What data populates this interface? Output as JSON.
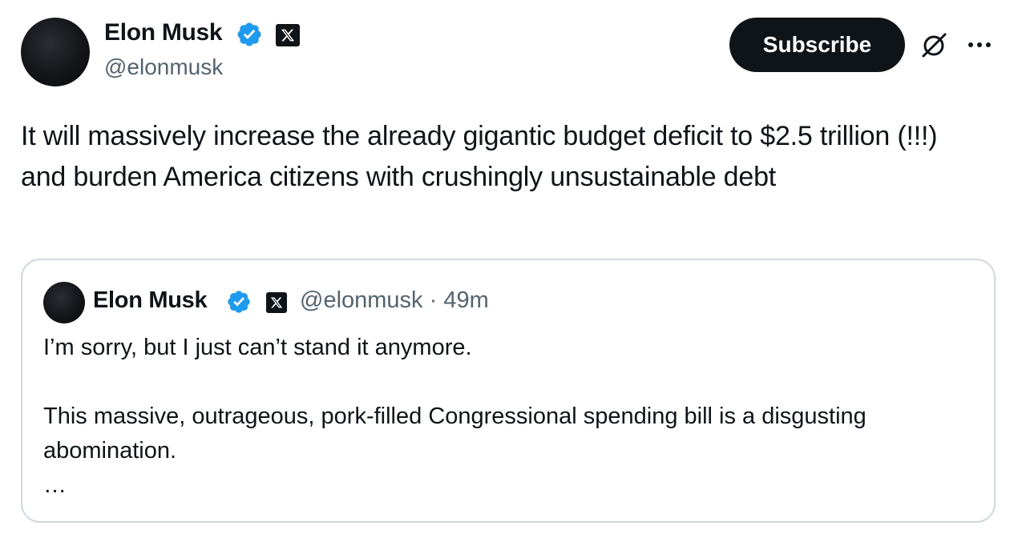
{
  "post": {
    "author": {
      "name": "Elon Musk",
      "handle": "@elonmusk",
      "verified_icon": "verified-badge-icon",
      "affiliate_icon": "x-logo-icon"
    },
    "subscribe_label": "Subscribe",
    "body": "It will massively increase the already gigantic budget deficit to $2.5 trillion (!!!) and burden America citizens with crushingly unsustainable debt"
  },
  "quoted": {
    "author": {
      "name": "Elon Musk",
      "handle": "@elonmusk"
    },
    "separator": "·",
    "time": "49m",
    "text": "I’m sorry, but I just can’t stand it anymore.\n\nThis massive, outrageous, pork-filled Congressional spending bill is a disgusting abomination.\n…"
  },
  "colors": {
    "text_primary": "#0f1419",
    "text_secondary": "#536471",
    "verified_blue": "#1d9bf0",
    "border": "#cfd9de",
    "button_bg": "#0f1419"
  }
}
